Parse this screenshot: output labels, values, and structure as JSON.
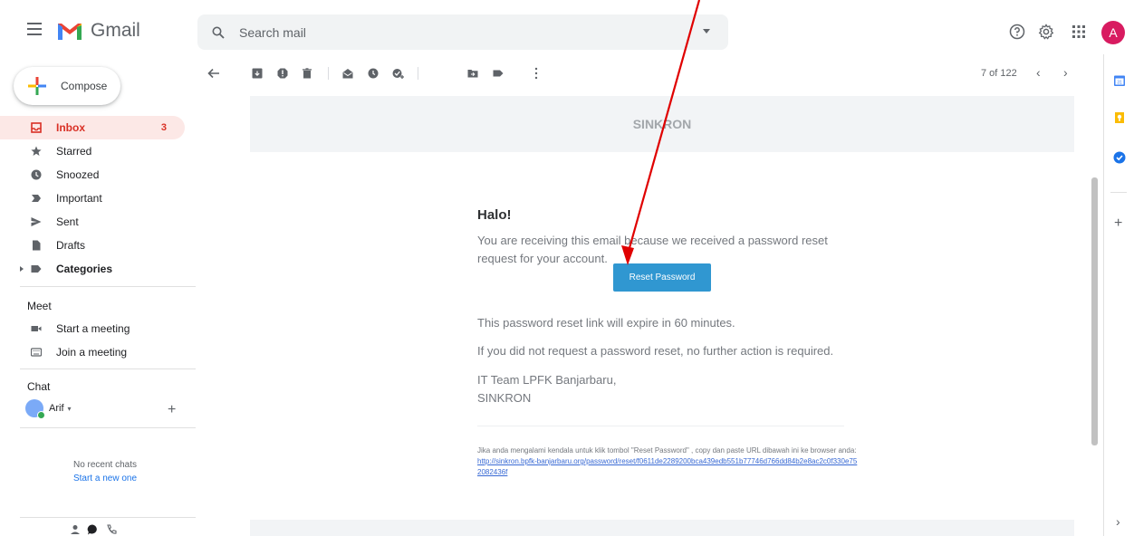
{
  "header": {
    "app_name": "Gmail",
    "search_placeholder": "Search mail",
    "avatar_letter": "A"
  },
  "sidebar": {
    "compose_label": "Compose",
    "items": [
      {
        "label": "Inbox",
        "count": "3",
        "icon": "inbox-icon"
      },
      {
        "label": "Starred",
        "icon": "star-icon"
      },
      {
        "label": "Snoozed",
        "icon": "clock-icon"
      },
      {
        "label": "Important",
        "icon": "important-icon"
      },
      {
        "label": "Sent",
        "icon": "send-icon"
      },
      {
        "label": "Drafts",
        "icon": "draft-icon"
      },
      {
        "label": "Categories",
        "icon": "label-icon"
      }
    ],
    "meet": {
      "title": "Meet",
      "start": "Start a meeting",
      "join": "Join a meeting"
    },
    "chat": {
      "title": "Chat",
      "user": "Arif",
      "no_recent": "No recent chats",
      "start_new": "Start a new one"
    }
  },
  "toolbar": {
    "pager": "7 of 122"
  },
  "email": {
    "banner": "SINKRON",
    "greeting": "Halo!",
    "intro": "You are receiving this email because we received a password reset request for your account.",
    "button": "Reset Password",
    "expire": "This password reset link will expire in 60 minutes.",
    "no_action": "If you did not request a password reset, no further action is required.",
    "signature_line1": "IT Team LPFK Banjarbaru,",
    "signature_line2": "SINKRON",
    "footnote_text": "Jika anda mengalami kendala untuk klik tombol \"Reset Password\" , copy dan paste URL dibawah ini ke browser anda: ",
    "footnote_link": "http://sinkron.bpfk-banjarbaru.org/password/reset/f0611de2289200bca439edb551b77746d766dd84b2e8ac2c0f330e752082436f"
  },
  "colors": {
    "accent_red": "#d93025",
    "button_blue": "#3097d1",
    "annotation_arrow": "#e00000"
  }
}
